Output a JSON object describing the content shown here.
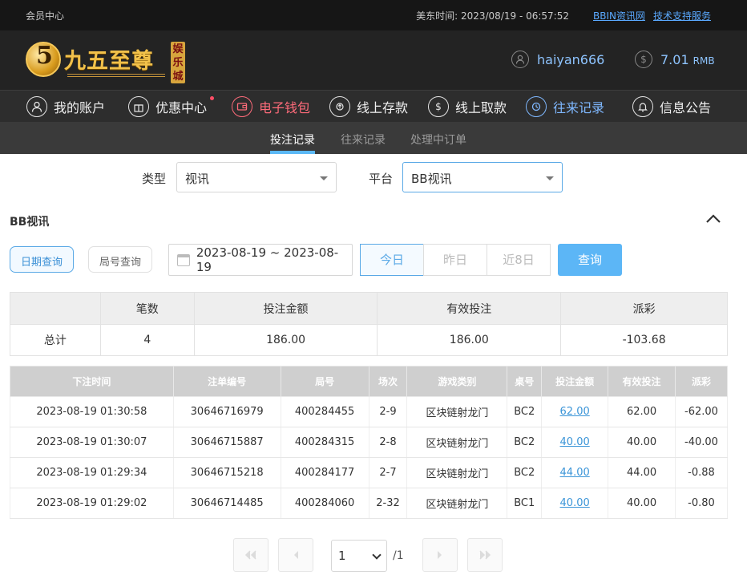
{
  "topbar": {
    "member_center": "会员中心",
    "time_label": "美东时间",
    "time_value": "2023/08/19 - 06:57:52",
    "links": [
      "BBIN资讯网",
      "技术支持服务"
    ]
  },
  "brand": {
    "logo_number": "5",
    "logo_name": "九五至尊",
    "logo_tag": "娱乐城",
    "username": "haiyan666",
    "balance": "7.01",
    "currency": "RMB"
  },
  "nav": [
    {
      "label": "我的账户",
      "icon": "user-icon"
    },
    {
      "label": "优惠中心",
      "icon": "gift-icon"
    },
    {
      "label": "电子钱包",
      "icon": "wallet-icon"
    },
    {
      "label": "线上存款",
      "icon": "deposit-icon"
    },
    {
      "label": "线上取款",
      "icon": "withdraw-icon"
    },
    {
      "label": "往来记录",
      "icon": "records-icon"
    },
    {
      "label": "信息公告",
      "icon": "bell-icon"
    }
  ],
  "subtabs": [
    "投注记录",
    "往来记录",
    "处理中订单"
  ],
  "filters": {
    "type_label": "类型",
    "type_value": "视讯",
    "platform_label": "平台",
    "platform_value": "BB视讯"
  },
  "section_title": "BB视讯",
  "query": {
    "by_date": "日期查询",
    "by_round": "局号查询",
    "date_range": "2023-08-19 ~ 2023-08-19",
    "today": "今日",
    "yesterday": "昨日",
    "last8": "近8日",
    "search": "查询"
  },
  "summary": {
    "headers": [
      "",
      "笔数",
      "投注金额",
      "有效投注",
      "派彩"
    ],
    "row": [
      "总计",
      "4",
      "186.00",
      "186.00",
      "-103.68"
    ]
  },
  "records": {
    "headers": [
      "下注时间",
      "注单编号",
      "局号",
      "场次",
      "游戏类别",
      "桌号",
      "投注金额",
      "有效投注",
      "派彩"
    ],
    "rows": [
      [
        "2023-08-19 01:30:58",
        "30646716979",
        "400284455",
        "2-9",
        "区块链射龙门",
        "BC2",
        "62.00",
        "62.00",
        "-62.00"
      ],
      [
        "2023-08-19 01:30:07",
        "30646715887",
        "400284315",
        "2-8",
        "区块链射龙门",
        "BC2",
        "40.00",
        "40.00",
        "-40.00"
      ],
      [
        "2023-08-19 01:29:34",
        "30646715218",
        "400284177",
        "2-7",
        "区块链射龙门",
        "BC2",
        "44.00",
        "44.00",
        "-0.88"
      ],
      [
        "2023-08-19 01:29:02",
        "30646714485",
        "400284060",
        "2-32",
        "区块链射龙门",
        "BC1",
        "40.00",
        "40.00",
        "-0.80"
      ]
    ]
  },
  "pager": {
    "current": "1",
    "total": "/1"
  },
  "colors": {
    "accent": "#5cb6f6",
    "negative": "#e54a4a",
    "nav_active_red": "#ff6b7a",
    "nav_active_blue": "#7fb8ff"
  }
}
